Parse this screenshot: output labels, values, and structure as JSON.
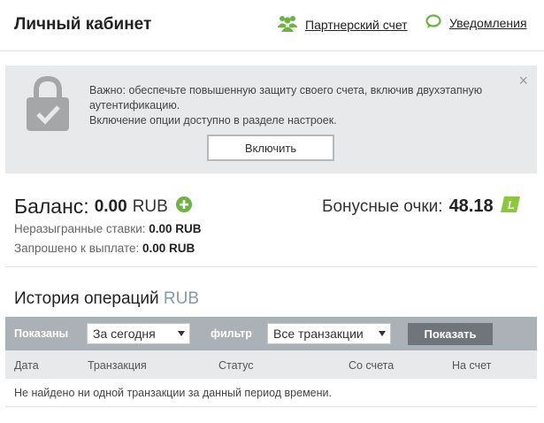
{
  "header": {
    "title": "Личный кабинет",
    "partner_link": "Партнерский счет",
    "notifications_link": "Уведомления"
  },
  "alert": {
    "line1": "Важно: обеспечьте повышенную защиту своего счета, включив двухэтапную аутентификацию.",
    "line2": "Включение опции доступно в разделе настроек.",
    "enable_button": "Включить",
    "close": "×"
  },
  "balance": {
    "label": "Баланс:",
    "value": "0.00",
    "currency": "RUB",
    "unsettled_label": "Неразыгранные ставки:",
    "unsettled_value": "0.00 RUB",
    "withdraw_label": "Запрошено к выплате:",
    "withdraw_value": "0.00 RUB"
  },
  "bonus": {
    "label": "Бонусные очки:",
    "value": "48.18",
    "badge": "L"
  },
  "history": {
    "title": "История операций",
    "currency": "RUB"
  },
  "filters": {
    "shown_label": "Показаны",
    "period_value": "За сегодня",
    "filter_label": "фильтр",
    "filter_value": "Все транзакции",
    "show_button": "Показать"
  },
  "table": {
    "columns": [
      "Дата",
      "Транзакция",
      "Статус",
      "Со счета",
      "На счет"
    ],
    "empty_message": "Не найдено ни одной транзакции за данный период времени."
  },
  "colors": {
    "green": "#6cb33f",
    "filter_bar": "#aab2b8",
    "button_dark": "#6e767c",
    "panel_bg": "#e8e9eb"
  }
}
